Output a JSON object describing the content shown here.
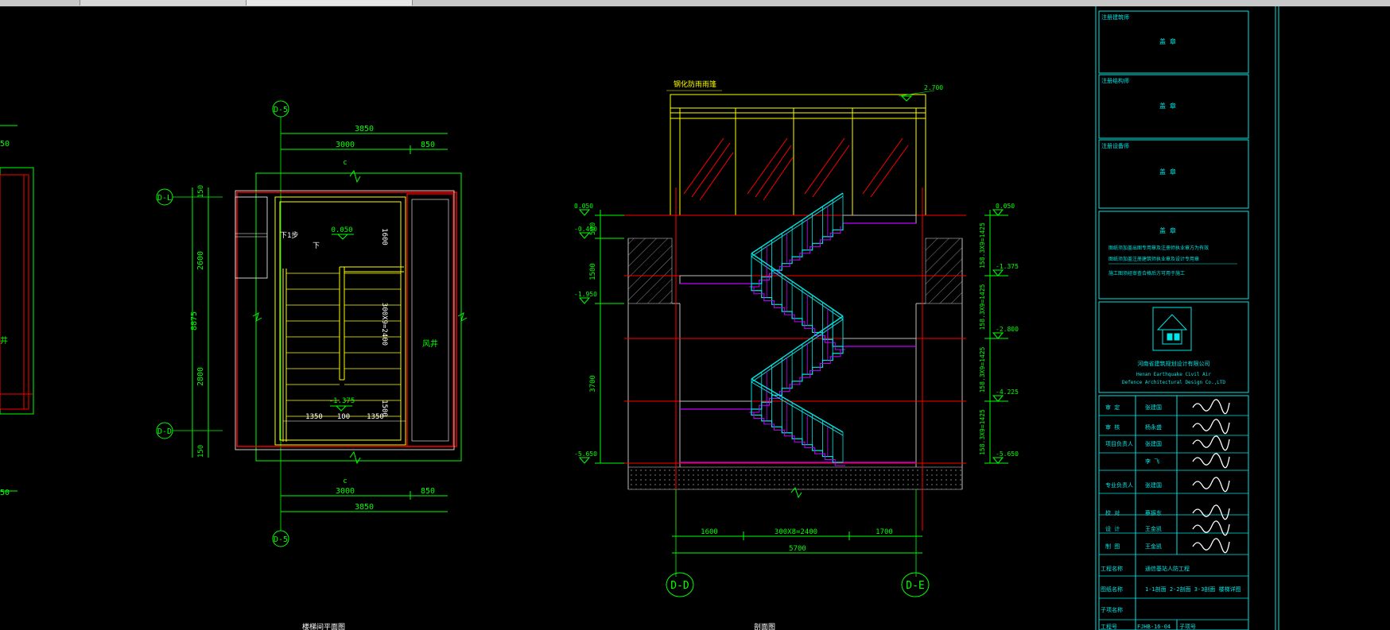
{
  "colors": {
    "bg": "#000000",
    "green": "#00ff00",
    "cyan": "#00e5e5",
    "yellow": "#ffff00",
    "red": "#ff0000",
    "white": "#ffffff",
    "magenta": "#c000ff",
    "gray": "#bbbbbb",
    "toolbar": "#c8c8c8"
  },
  "plan": {
    "axis_top": "D-5",
    "axis_bottom": "D-5",
    "axis_left_top": "D-L",
    "axis_left_bottom": "D-D",
    "dim_top_total": "3850",
    "dim_top_a": "3000",
    "dim_top_b": "850",
    "dim_bot_total": "3850",
    "dim_bot_a": "3000",
    "dim_bot_b": "850",
    "dim_left_150a": "150",
    "dim_left_2600": "2600",
    "dim_left_2800": "2800",
    "dim_left_150b": "150",
    "dim_left_total": "8875",
    "elev_top": "0.050",
    "elev_bottom": "-1.375",
    "run_dim": "300X9=2400",
    "landing_dim_top": "1600",
    "landing_dim_bottom": "1500",
    "flight_a": "1350",
    "gap": "100",
    "flight_b": "1350",
    "label_shaft": "风井",
    "label_down": "下",
    "label_up": "下1步",
    "letter_c": "c"
  },
  "section": {
    "roof_label": "钢化防雨雨篷",
    "roof_elev": "2.700",
    "left_elevs": [
      "0.050",
      "-0.450",
      "-1.950",
      "-5.650"
    ],
    "left_dims": [
      "500",
      "1500",
      "3700"
    ],
    "right_elevs": [
      "0.050",
      "-1.375",
      "-2.800",
      "-4.225",
      "-5.650"
    ],
    "right_dims": [
      "158.3X9=1425",
      "158.3X9=1425",
      "158.3X9=1425",
      "158.3X9=1425"
    ],
    "bottom_dims": [
      "1600",
      "300X8=2400",
      "1700"
    ],
    "bottom_total": "5700",
    "axis_left": "D-D",
    "axis_right": "D-E"
  },
  "left_fragment": {
    "dim_a": "50",
    "dim_b": "50",
    "label": "井"
  },
  "bottom_captions": [
    "楼梯间平面图",
    "剖面图"
  ],
  "titleblock": {
    "row1_label": "注册建筑师",
    "row2_label": "注册结构师",
    "row3_label": "注册设备师",
    "seal": "盖 章",
    "notes_title": "盖 章",
    "notes": [
      "图纸须加盖出图专用章及注册师执业章方为有效",
      "图纸须加盖注册建筑师执业章及设计专用章",
      "施工图须经审查合格后方可用于施工"
    ],
    "company_cn": "河南省建筑规划设计有限公司",
    "company_en1": "Henan Earthquake Civil Air",
    "company_en2": "Defence Architectural Design Co.,LTD",
    "staff": [
      {
        "role": "审 定",
        "name": "张建国"
      },
      {
        "role": "审 核",
        "name": "杨永盛"
      },
      {
        "role": "项目负责人",
        "name": "张建国"
      },
      {
        "role": "",
        "name": "李 飞"
      },
      {
        "role": "专业负责人",
        "name": "张建国"
      },
      {
        "role": "校 对",
        "name": "蔡振东"
      },
      {
        "role": "设 计",
        "name": "王金凯"
      },
      {
        "role": "制 图",
        "name": "王金凯"
      }
    ],
    "project_label": "工程名称",
    "project_value": "通信基站人防工程",
    "drawing_label": "图纸名称",
    "drawing_value": "1-1剖面 2-2剖面 3-3剖面 楼梯详图",
    "subitem_label": "子项名称",
    "number_label": "工程号",
    "number_value": "FJHB-16-04",
    "sheet_label": "子项号"
  }
}
